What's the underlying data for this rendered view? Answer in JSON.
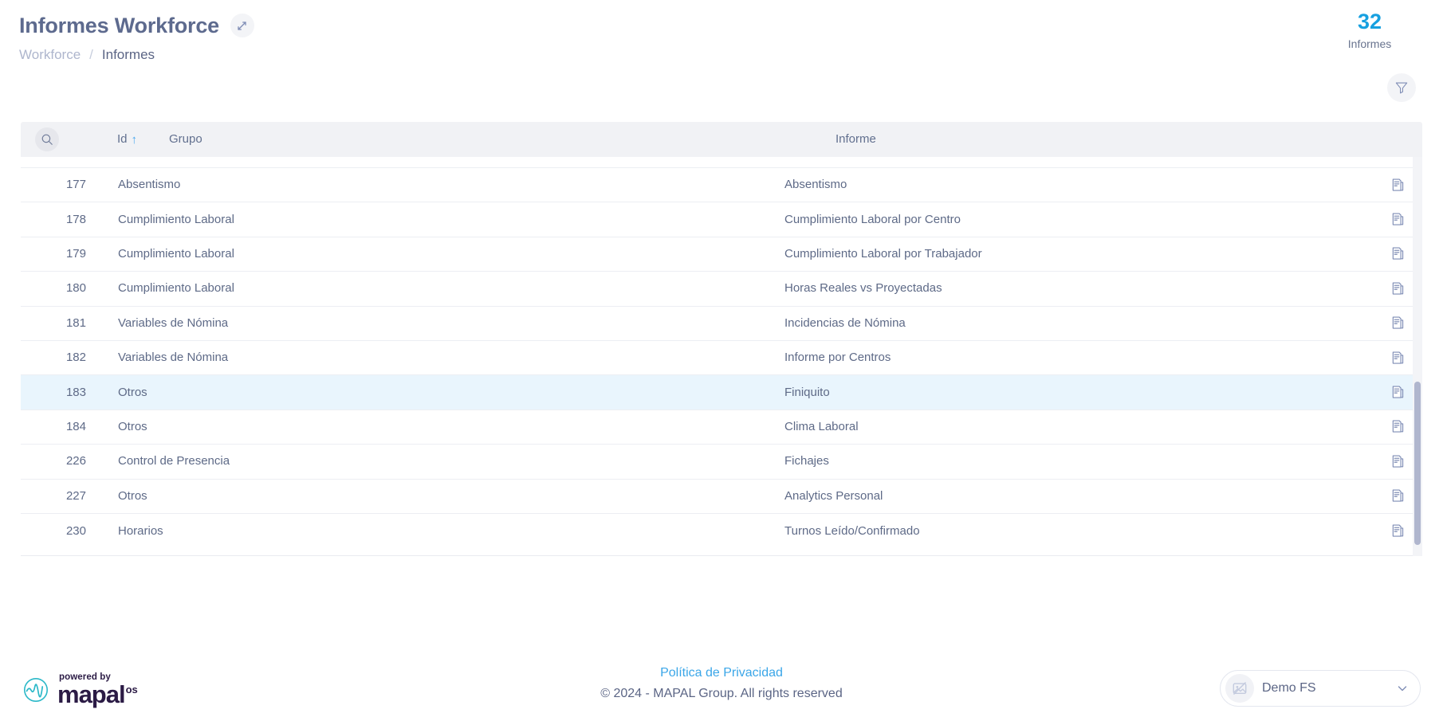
{
  "header": {
    "title": "Informes Workforce",
    "expand_icon": "expand-diagonal-icon",
    "breadcrumb": {
      "root": "Workforce",
      "separator": "/",
      "current": "Informes"
    },
    "counter": {
      "value": "32",
      "label": "Informes",
      "color": "#17a0e0"
    },
    "filter_icon": "funnel-filter-icon"
  },
  "table": {
    "search_icon": "search-icon",
    "columns": {
      "id": "Id",
      "grupo": "Grupo",
      "informe": "Informe"
    },
    "sort": {
      "column": "Id",
      "direction": "ascending",
      "arrow": "↑",
      "arrow_color": "#4aa8ef"
    },
    "row_action_icon": "report-document-icon",
    "rows": [
      {
        "id": "177",
        "grupo": "Absentismo",
        "informe": "Absentismo",
        "highlighted": false
      },
      {
        "id": "178",
        "grupo": "Cumplimiento Laboral",
        "informe": "Cumplimiento Laboral por Centro",
        "highlighted": false
      },
      {
        "id": "179",
        "grupo": "Cumplimiento Laboral",
        "informe": "Cumplimiento Laboral por Trabajador",
        "highlighted": false
      },
      {
        "id": "180",
        "grupo": "Cumplimiento Laboral",
        "informe": "Horas Reales vs Proyectadas",
        "highlighted": false
      },
      {
        "id": "181",
        "grupo": "Variables de Nómina",
        "informe": "Incidencias de Nómina",
        "highlighted": false
      },
      {
        "id": "182",
        "grupo": "Variables de Nómina",
        "informe": "Informe por Centros",
        "highlighted": false
      },
      {
        "id": "183",
        "grupo": "Otros",
        "informe": "Finiquito",
        "highlighted": true
      },
      {
        "id": "184",
        "grupo": "Otros",
        "informe": "Clima Laboral",
        "highlighted": false
      },
      {
        "id": "226",
        "grupo": "Control de Presencia",
        "informe": "Fichajes",
        "highlighted": false
      },
      {
        "id": "227",
        "grupo": "Otros",
        "informe": "Analytics Personal",
        "highlighted": false
      },
      {
        "id": "230",
        "grupo": "Horarios",
        "informe": "Turnos Leído/Confirmado",
        "highlighted": false
      }
    ]
  },
  "footer": {
    "brand": {
      "powered_by": "powered by",
      "name": "mapal",
      "suffix": "os",
      "logo_icon": "mapal-wave-circle-icon"
    },
    "privacy_link": "Política de Privacidad",
    "copyright": "© 2024 - MAPAL Group. All rights reserved",
    "site_selector": {
      "value": "Demo FS",
      "avatar_icon": "no-image-placeholder-icon",
      "chevron_icon": "chevron-down-icon"
    }
  }
}
